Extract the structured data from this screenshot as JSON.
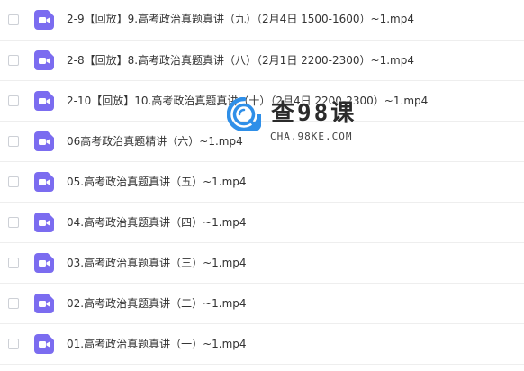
{
  "files": [
    {
      "name": "2-9【回放】9.高考政治真题真讲（九）（2月4日 1500-1600）~1.mp4",
      "icon": "video-icon"
    },
    {
      "name": "2-8【回放】8.高考政治真题真讲（八）（2月1日 2200-2300）~1.mp4",
      "icon": "video-icon"
    },
    {
      "name": "2-10【回放】10.高考政治真题真讲（十）（2月4日 2200-2300）~1.mp4",
      "icon": "video-icon"
    },
    {
      "name": "06高考政治真题精讲（六）~1.mp4",
      "icon": "video-icon"
    },
    {
      "name": "05.高考政治真题真讲（五）~1.mp4",
      "icon": "video-icon"
    },
    {
      "name": "04.高考政治真题真讲（四）~1.mp4",
      "icon": "video-icon"
    },
    {
      "name": "03.高考政治真题真讲（三）~1.mp4",
      "icon": "video-icon"
    },
    {
      "name": "02.高考政治真题真讲（二）~1.mp4",
      "icon": "video-icon"
    },
    {
      "name": "01.高考政治真题真讲（一）~1.mp4",
      "icon": "video-icon"
    }
  ],
  "watermark": {
    "title": "查98课",
    "subtitle": "CHA.98KE.COM"
  },
  "colors": {
    "icon_purple": "#7b6cf0",
    "logo_blue": "#2f8fe8",
    "text": "#333333",
    "divider": "#eeeeee"
  }
}
